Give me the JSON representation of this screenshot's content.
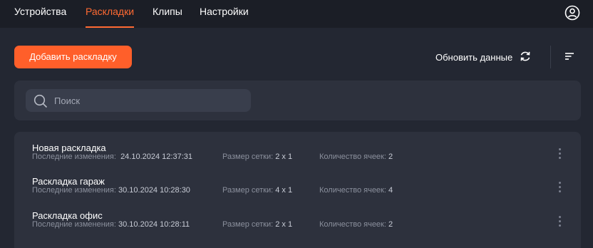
{
  "nav": {
    "tabs": [
      {
        "label": "Устройства"
      },
      {
        "label": "Раскладки"
      },
      {
        "label": "Клипы"
      },
      {
        "label": "Настройки"
      }
    ],
    "active_tab": "Раскладки",
    "profile_icon": "user-circle-icon"
  },
  "toolbar": {
    "add_label": "Добавить раскладку",
    "refresh_label": "Обновить данные",
    "refresh_icon": "refresh-icon",
    "sort_icon": "sort-icon"
  },
  "search": {
    "placeholder": "Поиск",
    "value": ""
  },
  "labels": {
    "last_changed": "Последние изменения:",
    "grid_size": "Размер сетки:",
    "cell_count": "Количество ячеек:"
  },
  "layouts": [
    {
      "name": "Новая раскладка",
      "modified": "24.10.2024 12:37:31",
      "grid": "2 x 1",
      "cells": "2"
    },
    {
      "name": "Раскладка гараж",
      "modified": "30.10.2024 10:28:30",
      "grid": "4 x 1",
      "cells": "4"
    },
    {
      "name": "Раскладка офис",
      "modified": "30.10.2024 10:28:11",
      "grid": "2 x 1",
      "cells": "2"
    }
  ],
  "colors": {
    "accent": "#ff5f2a",
    "background": "#232732",
    "panel": "#2d313d",
    "topbar": "#1b1e26"
  }
}
